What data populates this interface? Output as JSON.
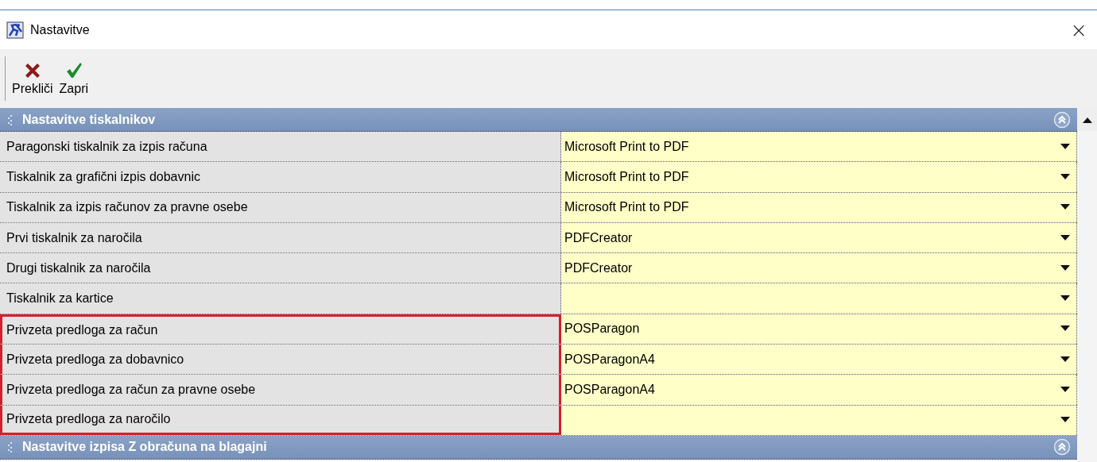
{
  "window": {
    "title": "Nastavitve",
    "close": "×"
  },
  "toolbar": [
    {
      "kind": "cancel",
      "label": "Prekliči"
    },
    {
      "kind": "confirm",
      "label": "Zapri"
    }
  ],
  "sections": [
    {
      "title": "Nastavitve tiskalnikov",
      "expanded": true,
      "rows": [
        {
          "label": "Paragonski tiskalnik za izpis računa",
          "value": "Microsoft Print to PDF",
          "highlighted": false
        },
        {
          "label": "Tiskalnik za grafični izpis dobavnic",
          "value": "Microsoft Print to PDF",
          "highlighted": false
        },
        {
          "label": "Tiskalnik za izpis računov za pravne osebe",
          "value": "Microsoft Print to PDF",
          "highlighted": false
        },
        {
          "label": "Prvi tiskalnik za naročila",
          "value": "PDFCreator",
          "highlighted": false
        },
        {
          "label": "Drugi tiskalnik za naročila",
          "value": "PDFCreator",
          "highlighted": false
        },
        {
          "label": "Tiskalnik za kartice",
          "value": "",
          "highlighted": false
        },
        {
          "label": "Privzeta predloga za račun",
          "value": "POSParagon",
          "highlighted": true
        },
        {
          "label": "Privzeta predloga za dobavnico",
          "value": "POSParagonA4",
          "highlighted": true
        },
        {
          "label": "Privzeta predloga za račun za pravne osebe",
          "value": "POSParagonA4",
          "highlighted": true
        },
        {
          "label": "Privzeta predloga za naročilo",
          "value": "",
          "highlighted": true
        }
      ]
    },
    {
      "title": "Nastavitve izpisa Z obračuna na blagajni",
      "expanded": true
    }
  ]
}
